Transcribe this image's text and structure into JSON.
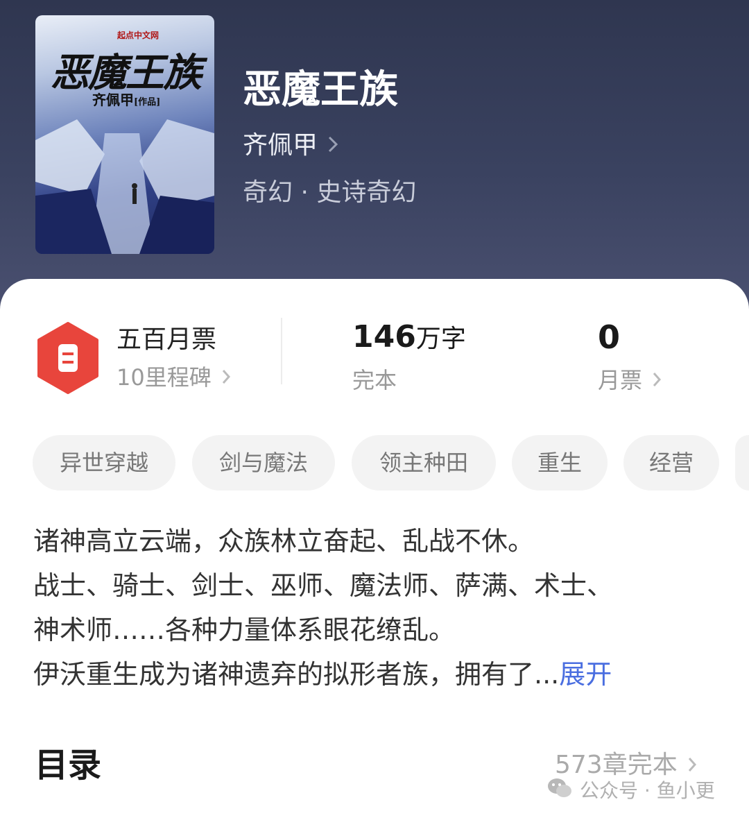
{
  "book": {
    "title": "恶魔王族",
    "author": "齐佩甲",
    "genre": "奇幻 · 史诗奇幻"
  },
  "cover": {
    "title": "恶魔王族",
    "author": "齐佩甲",
    "author_suffix": "[作品]",
    "publisher": "起点中文网"
  },
  "stats": {
    "badge_title": "五百月票",
    "badge_sub": "10里程碑",
    "words_value": "146",
    "words_unit": "万字",
    "words_label": "完本",
    "votes_value": "0",
    "votes_label": "月票"
  },
  "tags": [
    "异世穿越",
    "剑与魔法",
    "领主种田",
    "重生",
    "经营"
  ],
  "description": {
    "lines": [
      "诸神高立云端，众族林立奋起、乱战不休。",
      "战士、骑士、剑士、巫师、魔法师、萨满、术士、",
      "神术师……各种力量体系眼花缭乱。",
      "伊沃重生成为诸神遗弃的拟形者族，拥有了..."
    ],
    "expand_label": "展开"
  },
  "toc": {
    "title": "目录",
    "count": "573章完本"
  },
  "watermark": {
    "text": "公众号 · 鱼小更"
  },
  "colors": {
    "header_bg": "#343b57",
    "accent_blue": "#4a6ee0",
    "badge_red": "#e8453c"
  }
}
